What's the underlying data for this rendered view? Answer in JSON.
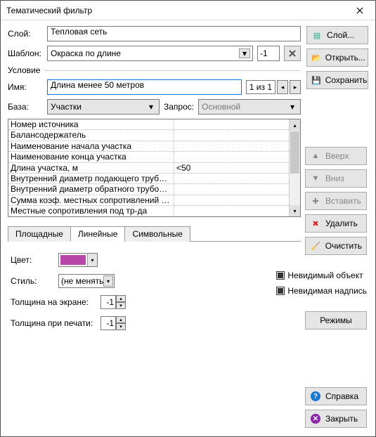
{
  "window": {
    "title": "Тематический фильтр"
  },
  "top": {
    "layer_label": "Слой:",
    "layer_value": "Тепловая сеть",
    "template_label": "Шаблон:",
    "template_value": "Окраска по длине",
    "template_num": "-1"
  },
  "right_buttons": {
    "layer": "Слой...",
    "open": "Открыть...",
    "save": "Сохранить"
  },
  "condition": {
    "section": "Условие",
    "name_label": "Имя:",
    "name_value": "Длина менее 50 метров",
    "counter": "1 из 1",
    "base_label": "База:",
    "base_value": "Участки",
    "query_label": "Запрос:",
    "query_value": "Основной"
  },
  "grid_rows": [
    {
      "f": "Номер источника",
      "v": ""
    },
    {
      "f": "Балансодержатель",
      "v": ""
    },
    {
      "f": "Наименование начала участка",
      "v": ""
    },
    {
      "f": "Наименование конца участка",
      "v": ""
    },
    {
      "f": "Длина участка, м",
      "v": "<50"
    },
    {
      "f": "Внутренний диаметр подающего трубопровод...",
      "v": ""
    },
    {
      "f": "Внутренний диаметр обратного трубопровода...",
      "v": ""
    },
    {
      "f": "Сумма коэф. местных сопротивлений под. тр...",
      "v": ""
    },
    {
      "f": "Местные сопротивления под тр-да",
      "v": ""
    }
  ],
  "list_buttons": {
    "up": "Вверх",
    "down": "Вниз",
    "insert": "Вставить",
    "delete": "Удалить",
    "clear": "Очистить"
  },
  "tabs": {
    "area": "Площадные",
    "line": "Линейные",
    "symbol": "Символьные"
  },
  "style": {
    "color_label": "Цвет:",
    "color_value": "#b846a8",
    "style_label": "Стиль:",
    "style_value": "(не менять)",
    "screen_thickness_label": "Толщина на экране:",
    "screen_thickness_value": "-1",
    "print_thickness_label": "Толщина при печати:",
    "print_thickness_value": "-1"
  },
  "checks": {
    "inv_object": "Невидимый объект",
    "inv_label": "Невидимая надпись"
  },
  "modes_button": "Режимы",
  "footer": {
    "help": "Справка",
    "close": "Закрыть"
  }
}
